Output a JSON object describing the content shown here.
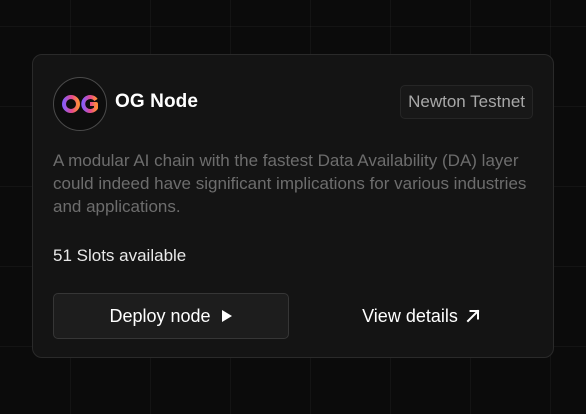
{
  "card": {
    "logo_text": "OG",
    "title": "OG Node",
    "network_badge": "Newton Testnet",
    "description": "A modular AI chain with the fastest Data Availability (DA) layer could indeed have significant implications for various industries and applications.",
    "slots": "51 Slots available",
    "deploy_label": "Deploy node",
    "details_label": "View details",
    "icons": {
      "deploy": "play-icon",
      "details": "arrow-up-right-icon"
    },
    "colors": {
      "logo_gradient": [
        "#8b5cf6",
        "#e4488e",
        "#ff8a3d"
      ],
      "accent_bg": "#141414"
    }
  }
}
